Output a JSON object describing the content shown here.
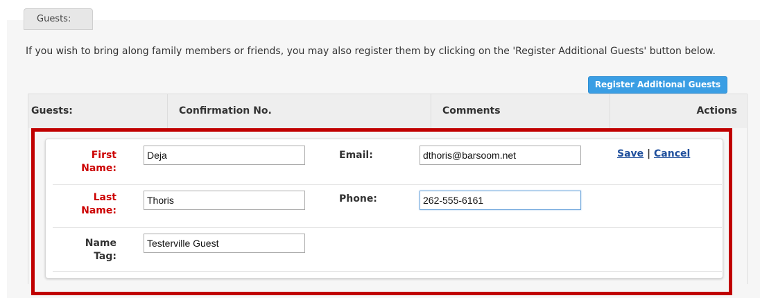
{
  "section": {
    "tab_label": "Guests:",
    "intro_text": "If you wish to bring along family members or friends, you may also register them by clicking on the 'Register Additional Guests' button below.",
    "register_button_label": "Register Additional Guests"
  },
  "table": {
    "headers": {
      "guests": "Guests:",
      "confirmation": "Confirmation No.",
      "comments": "Comments",
      "actions": "Actions"
    }
  },
  "guest_form": {
    "first_name": {
      "label_line1": "First",
      "label_line2": "Name:",
      "value": "Deja",
      "required": true
    },
    "last_name": {
      "label_line1": "Last",
      "label_line2": "Name:",
      "value": "Thoris",
      "required": true
    },
    "name_tag": {
      "label_line1": "Name",
      "label_line2": "Tag:",
      "value": "Testerville Guest",
      "required": false
    },
    "email": {
      "label": "Email:",
      "value": "dthoris@barsoom.net"
    },
    "phone": {
      "label": "Phone:",
      "value": "262-555-6161"
    },
    "actions": {
      "save": "Save",
      "separator": "|",
      "cancel": "Cancel"
    }
  },
  "colors": {
    "required_label": "#cc0000",
    "highlight_border": "#c00000",
    "button_bg": "#3a9ee4",
    "link": "#1f4f9c"
  }
}
